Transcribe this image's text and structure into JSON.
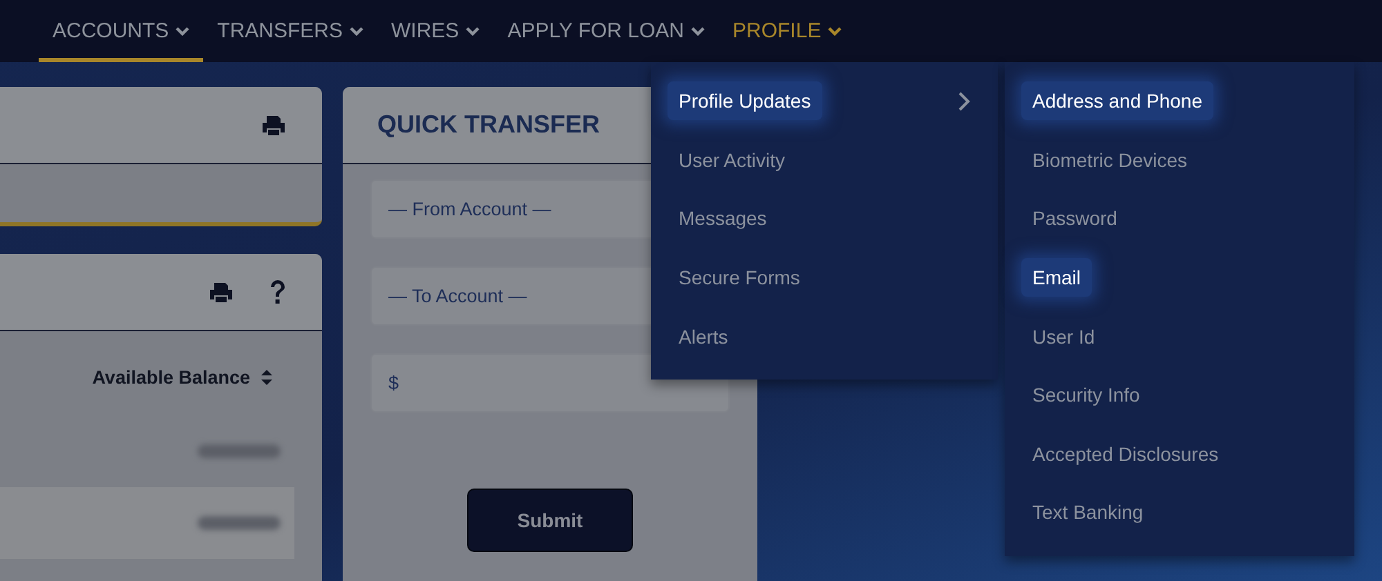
{
  "nav": [
    {
      "label": "ACCOUNTS",
      "selected": true,
      "open": false
    },
    {
      "label": "TRANSFERS",
      "selected": false,
      "open": false
    },
    {
      "label": "WIRES",
      "selected": false,
      "open": false
    },
    {
      "label": "APPLY FOR LOAN",
      "selected": false,
      "open": false
    },
    {
      "label": "PROFILE",
      "selected": false,
      "open": true
    }
  ],
  "balances_card": {
    "column_header": "Available Balance"
  },
  "quick_transfer": {
    "title": "QUICK TRANSFER",
    "from_placeholder": "— From Account —",
    "to_placeholder": "— To Account —",
    "amount_prefix": "$",
    "submit": "Submit"
  },
  "profile_menu": [
    {
      "label": "Profile Updates",
      "highlighted": true,
      "has_submenu": true
    },
    {
      "label": "User Activity",
      "highlighted": false,
      "has_submenu": false
    },
    {
      "label": "Messages",
      "highlighted": false,
      "has_submenu": false
    },
    {
      "label": "Secure Forms",
      "highlighted": false,
      "has_submenu": false
    },
    {
      "label": "Alerts",
      "highlighted": false,
      "has_submenu": false
    }
  ],
  "submenu": [
    {
      "label": "Address and Phone",
      "highlighted": true
    },
    {
      "label": "Biometric Devices",
      "highlighted": false
    },
    {
      "label": "Password",
      "highlighted": false
    },
    {
      "label": "Email",
      "highlighted": true
    },
    {
      "label": "User Id",
      "highlighted": false
    },
    {
      "label": "Security Info",
      "highlighted": false
    },
    {
      "label": "Accepted Disclosures",
      "highlighted": false
    },
    {
      "label": "Text Banking",
      "highlighted": false
    }
  ]
}
